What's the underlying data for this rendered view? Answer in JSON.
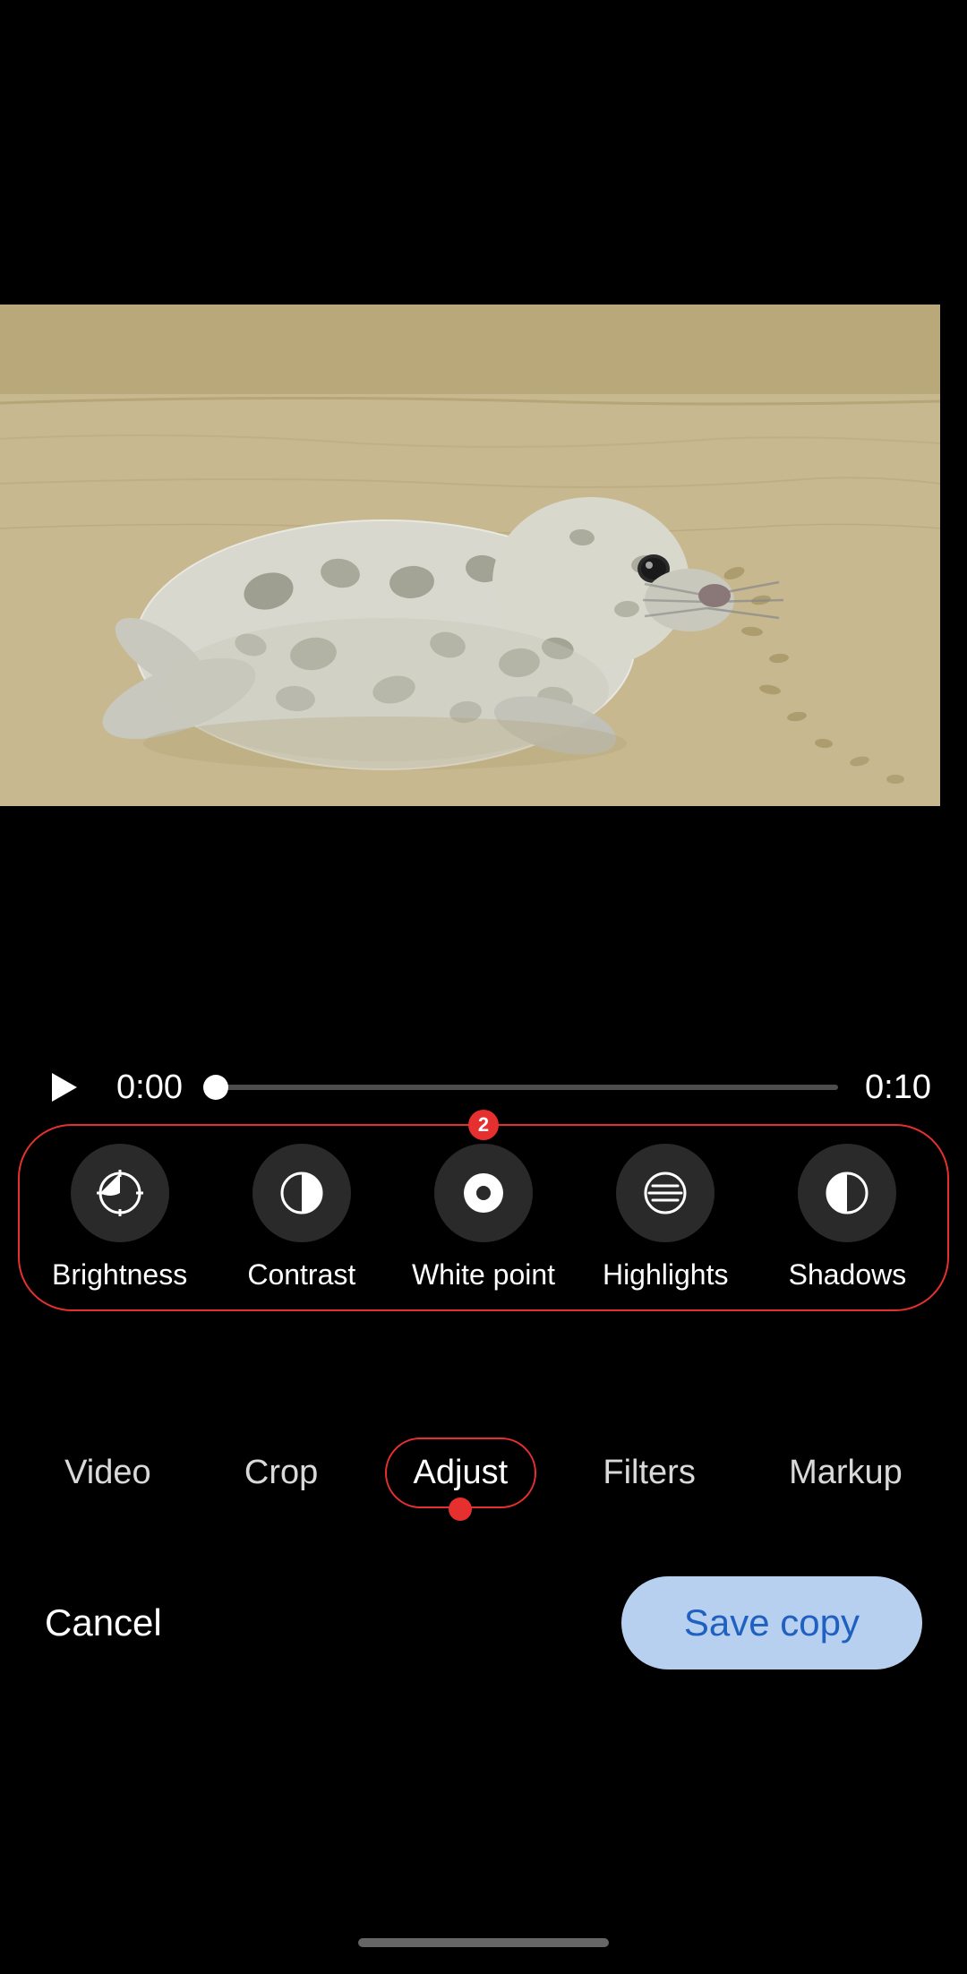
{
  "playback": {
    "time_current": "0:00",
    "time_total": "0:10",
    "play_label": "▶"
  },
  "tools_badge": "2",
  "adjust_badge_visible": true,
  "tools": [
    {
      "id": "brightness",
      "label": "Brightness",
      "icon": "brightness-icon"
    },
    {
      "id": "contrast",
      "label": "Contrast",
      "icon": "contrast-icon"
    },
    {
      "id": "white-point",
      "label": "White point",
      "icon": "white-point-icon"
    },
    {
      "id": "highlights",
      "label": "Highlights",
      "icon": "highlights-icon"
    },
    {
      "id": "shadows",
      "label": "Shadows",
      "icon": "shadows-icon"
    }
  ],
  "tabs": [
    {
      "id": "video",
      "label": "Video",
      "active": false
    },
    {
      "id": "crop",
      "label": "Crop",
      "active": false
    },
    {
      "id": "adjust",
      "label": "Adjust",
      "active": true
    },
    {
      "id": "filters",
      "label": "Filters",
      "active": false
    },
    {
      "id": "markup",
      "label": "Markup",
      "active": false
    }
  ],
  "actions": {
    "cancel": "Cancel",
    "save_copy": "Save copy"
  }
}
